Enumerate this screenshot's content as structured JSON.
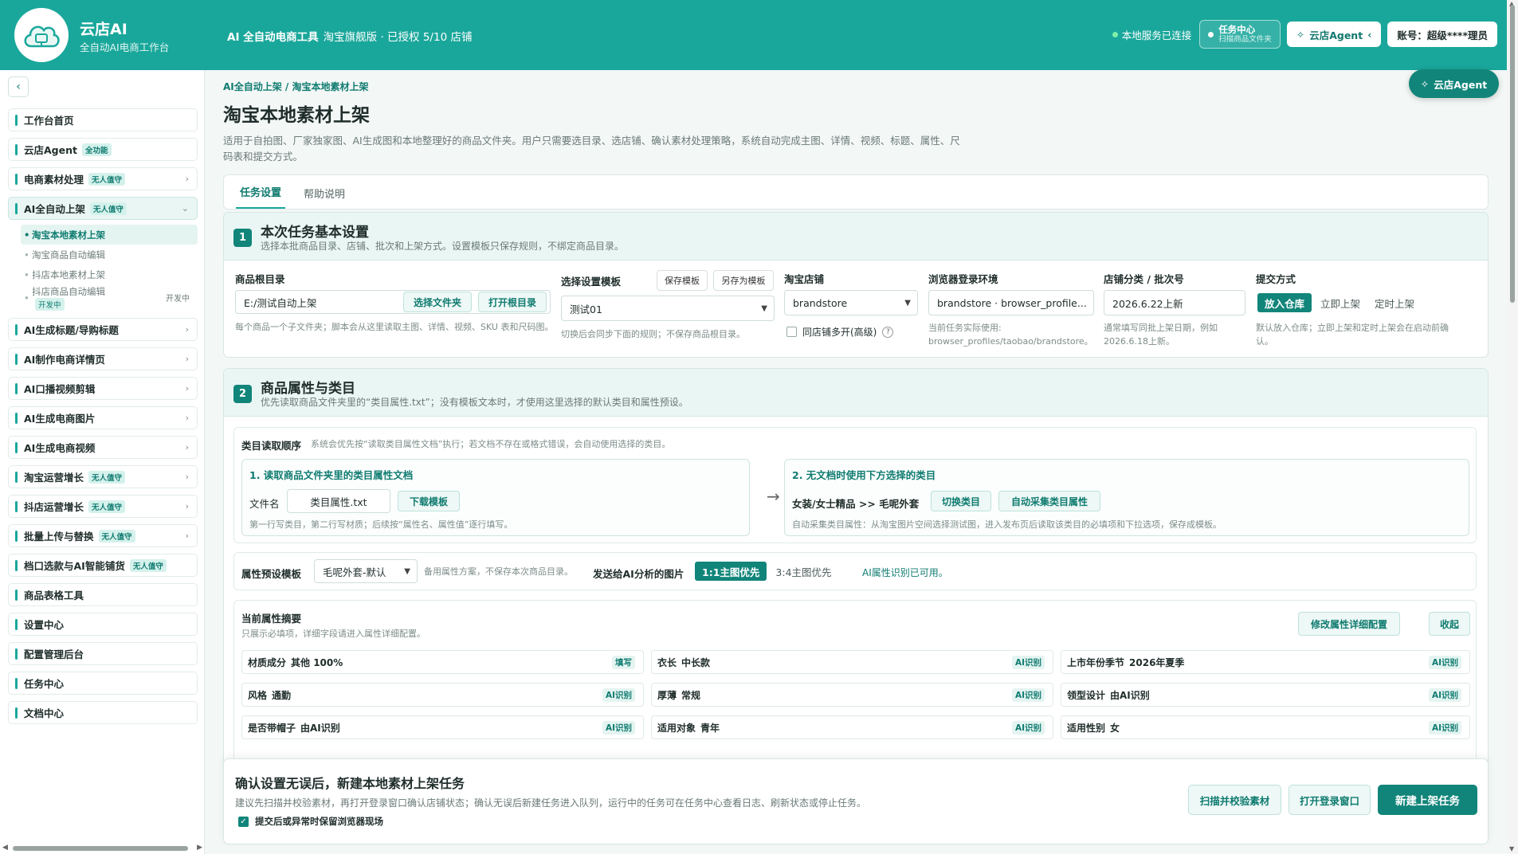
{
  "header": {
    "brand_name": "云店AI",
    "brand_sub": "全自动AI电商工作台",
    "title_bold": "AI 全自动电商工具",
    "title_rest": "淘宝旗舰版 · 已授权 5/10 店铺",
    "service_status": "本地服务已连接",
    "task_center_title": "任务中心",
    "task_center_sub": "扫描商品文件夹",
    "agent_label": "云店Agent",
    "account_label": "账号：超级****理员"
  },
  "sidebar": {
    "items": [
      {
        "label": "工作台首页",
        "badge": "",
        "chevron": ""
      },
      {
        "label": "云店Agent",
        "badge": "全功能",
        "chevron": ""
      },
      {
        "label": "电商素材处理",
        "badge": "无人值守",
        "chevron": "›"
      },
      {
        "label": "AI全自动上架",
        "badge": "无人值守",
        "chevron": "⌄"
      },
      {
        "label": "AI生成标题/导购标题",
        "badge": "",
        "chevron": "›"
      },
      {
        "label": "AI制作电商详情页",
        "badge": "",
        "chevron": "›"
      },
      {
        "label": "AI口播视频剪辑",
        "badge": "",
        "chevron": "›"
      },
      {
        "label": "AI生成电商图片",
        "badge": "",
        "chevron": "›"
      },
      {
        "label": "AI生成电商视频",
        "badge": "",
        "chevron": "›"
      },
      {
        "label": "淘宝运营增长",
        "badge": "无人值守",
        "chevron": "›"
      },
      {
        "label": "抖店运营增长",
        "badge": "无人值守",
        "chevron": "›"
      },
      {
        "label": "批量上传与替换",
        "badge": "无人值守",
        "chevron": "›"
      },
      {
        "label": "档口选款与AI智能铺货",
        "badge": "无人值守",
        "chevron": ""
      },
      {
        "label": "商品表格工具",
        "badge": "",
        "chevron": ""
      },
      {
        "label": "设置中心",
        "badge": "",
        "chevron": ""
      },
      {
        "label": "配置管理后台",
        "badge": "",
        "chevron": ""
      },
      {
        "label": "任务中心",
        "badge": "",
        "chevron": ""
      },
      {
        "label": "文档中心",
        "badge": "",
        "chevron": ""
      }
    ],
    "sub_items": [
      {
        "label": "淘宝本地素材上架"
      },
      {
        "label": "淘宝商品自动编辑"
      },
      {
        "label": "抖店本地素材上架"
      },
      {
        "label": "抖店商品自动编辑",
        "badge1": "开发中",
        "badge2": "开发中"
      }
    ]
  },
  "page": {
    "breadcrumb": "AI全自动上架 / 淘宝本地素材上架",
    "title": "淘宝本地素材上架",
    "description": "适用于自拍图、厂家独家图、AI生成图和本地整理好的商品文件夹。用户只需要选目录、选店铺、确认素材处理策略，系统自动完成主图、详情、视频、标题、属性、尺码表和提交方式。",
    "tabs": [
      "任务设置",
      "帮助说明"
    ],
    "float_agent": "云店Agent"
  },
  "section1": {
    "num": "1",
    "title": "本次任务基本设置",
    "subtitle": "选择本批商品目录、店铺、批次和上架方式。设置模板只保存规则，不绑定商品目录。",
    "root_label": "商品根目录",
    "root_value": "E:/测试自动上架",
    "choose_folder": "选择文件夹",
    "open_root": "打开根目录",
    "root_hint": "每个商品一个子文件夹；脚本会从这里读取主图、详情、视频、SKU 表和尺码图。",
    "template_label": "选择设置模板",
    "save_template": "保存模板",
    "save_as_template": "另存为模板",
    "template_value": "测试01",
    "template_hint": "切换后会同步下面的规则；不保存商品根目录。",
    "shop_label": "淘宝店铺",
    "shop_value": "brandstore",
    "multi_open_label": "同店铺多开(高级)",
    "multi_open_help": "?",
    "browser_label": "浏览器登录环境",
    "browser_value": "brandstore · browser_profile...",
    "browser_hint_1": "当前任务实际使用:",
    "browser_hint_2": "browser_profiles/taobao/brandstore。",
    "batch_label": "店铺分类 / 批次号",
    "batch_value": "2026.6.22上新",
    "batch_hint": "通常填写同批上架日期，例如 2026.6.18上新。",
    "submit_label": "提交方式",
    "submit_options": [
      "放入仓库",
      "立即上架",
      "定时上架"
    ],
    "submit_hint": "默认放入仓库；立即上架和定时上架会在启动前确认。"
  },
  "section2": {
    "num": "2",
    "title": "商品属性与类目",
    "subtitle": "优先读取商品文件夹里的“类目属性.txt”；没有模板文本时，才使用这里选择的默认类目和属性预设。",
    "order_label": "类目读取顺序",
    "order_hint": "系统会优先按“读取类目属性文档”执行；若文档不存在或格式错误，会自动使用选择的类目。",
    "box1_title": "1. 读取商品文件夹里的类目属性文档",
    "file_name_label": "文件名",
    "file_name_value": "类目属性.txt",
    "download_template": "下载模板",
    "box1_hint": "第一行写类目，第二行写材质；后续按“属性名、属性值”逐行填写。",
    "arrow": "→",
    "box2_title": "2. 无文档时使用下方选择的类目",
    "category_path": "女装/女士精品 >> 毛呢外套",
    "switch_category": "切换类目",
    "auto_collect": "自动采集类目属性",
    "box2_hint": "自动采集类目属性：从淘宝图片空间选择测试图，进入发布页后读取该类目的必填项和下拉选项，保存成模板。",
    "preset_label": "属性预设模板",
    "preset_value": "毛呢外套-默认",
    "preset_hint": "备用属性方案，不保存本次商品目录。",
    "send_label": "发送给AI分析的图片",
    "send_options": [
      "1:1主图优先",
      "3:4主图优先"
    ],
    "ai_status": "AI属性识别已可用。",
    "summary_title": "当前属性摘要",
    "summary_sub": "只展示必填项，详细字段请进入属性详细配置。",
    "edit_config": "修改属性详细配置",
    "collapse": "收起",
    "attrs": [
      {
        "k": "材质成分",
        "v": "其他 100%",
        "tag": "填写"
      },
      {
        "k": "衣长",
        "v": "中长款",
        "tag": "AI识别"
      },
      {
        "k": "上市年份季节",
        "v": "2026年夏季",
        "tag": "AI识别"
      },
      {
        "k": "风格",
        "v": "通勤",
        "tag": "AI识别"
      },
      {
        "k": "厚薄",
        "v": "常规",
        "tag": "AI识别"
      },
      {
        "k": "领型设计",
        "v": "由AI识别",
        "tag": "AI识别"
      },
      {
        "k": "是否带帽子",
        "v": "由AI识别",
        "tag": "AI识别"
      },
      {
        "k": "适用对象",
        "v": "青年",
        "tag": "AI识别"
      },
      {
        "k": "适用性别",
        "v": "女",
        "tag": "AI识别"
      }
    ]
  },
  "bottom": {
    "title": "确认设置无误后，新建本地素材上架任务",
    "desc": "建议先扫描并校验素材，再打开登录窗口确认店铺状态；确认无误后新建任务进入队列，运行中的任务可在任务中心查看日志、刷新状态或停止任务。",
    "keep_browser": "提交后或异常时保留浏览器现场",
    "scan_btn": "扫描并校验素材",
    "login_btn": "打开登录窗口",
    "create_btn": "新建上架任务"
  },
  "colors": {
    "brand": "#1aa79b",
    "primary": "#12857a",
    "accent_text": "#0f7b70"
  }
}
